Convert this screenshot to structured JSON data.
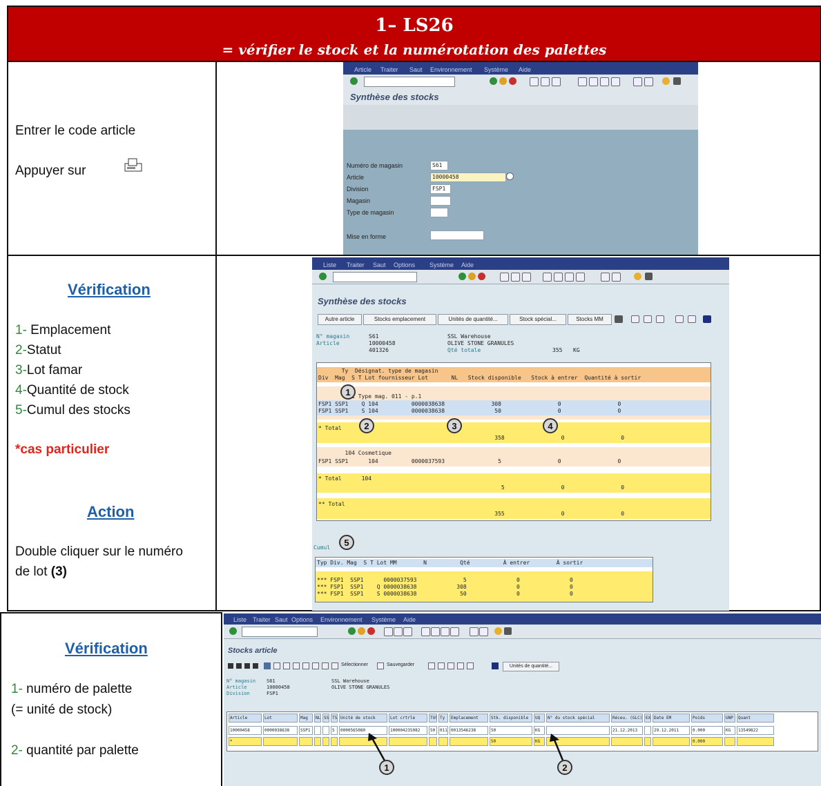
{
  "header": {
    "title": "1– LS26",
    "subtitle": "= vérifier le stock et la numérotation des palettes"
  },
  "row1": {
    "instruction_1": "Entrer le code article",
    "instruction_2": "Appuyer sur",
    "sap": {
      "menu": [
        "Article",
        "Traiter",
        "Saut",
        "Environnement",
        "Système",
        "Aide"
      ],
      "screen_title": "Synthèse des stocks",
      "fields": [
        {
          "label": "Numéro de magasin",
          "value": "S61"
        },
        {
          "label": "Article",
          "value": "10000458"
        },
        {
          "label": "Division",
          "value": "FSP1"
        },
        {
          "label": "Magasin",
          "value": ""
        },
        {
          "label": "Type de magasin",
          "value": ""
        },
        {
          "label": "Mise en forme",
          "value": ""
        }
      ]
    }
  },
  "row2": {
    "heading_1": "Vérification",
    "list": [
      {
        "num": "1-",
        "text": " Emplacement"
      },
      {
        "num": "2-",
        "text": "Statut"
      },
      {
        "num": "3-",
        "text": "Lot famar"
      },
      {
        "num": "4-",
        "text": "Quantité de stock"
      },
      {
        "num": "5-",
        "text": "Cumul des stocks"
      }
    ],
    "special_case": "*cas particulier",
    "heading_2": "Action",
    "action_1": "Double cliquer sur le numéro",
    "action_2_prefix": "de lot ",
    "action_2_bold": "(3)",
    "sap": {
      "menu": [
        "Liste",
        "Traiter",
        "Saut",
        "Options",
        "Système",
        "Aide"
      ],
      "screen_title": "Synthèse des stocks",
      "buttons": [
        "Autre article",
        "Stocks emplacement",
        "Unités de quantité...",
        "Stock spécial...",
        "Stocks MM"
      ],
      "info_left": [
        "N° magasin",
        "Article",
        ""
      ],
      "info_mid": [
        "S61",
        "10000458",
        "401326"
      ],
      "info_right": [
        "SSL Warehouse",
        "OLIVE STONE GRANULES",
        "Qté totale"
      ],
      "total_qty": "355",
      "unit": "KG",
      "col_row1": "       Ty  Désignat. type de magasin",
      "col_row2": "Div  Mag  S T Lot fournisseur Lot       NL   Stock disponible   Stock à entrer  Quantité à sortir",
      "group1_title": "        011 Type mag. 011 - p.1",
      "group1_rows": [
        "FSP1 SSP1    Q 104          0000038638              308                 0                 0",
        "FSP1 SSP1    S 104          0000038638               50                 0                 0"
      ],
      "total1_label": "* Total",
      "total1_vals": "                                                     358                 0                 0",
      "group2_title": "        104 Cosmetique",
      "group2_rows": [
        "FSP1 SSP1      104          0000037593                5                 0                 0"
      ],
      "total2_label": "* Total      104",
      "total2_vals": "                                                       5                 0                 0",
      "total3_label": "** Total",
      "total3_vals": "                                                     355                 0                 0",
      "cumul_label": "Cumul",
      "cumul_header": "Typ Div. Mag  S T Lot MM        N          Qté          À entrer        À sortir",
      "cumul_rows": [
        "*** FSP1  SSP1      0000037593              5               0               0",
        "*** FSP1  SSP1    Q 0000038638            308               0               0",
        "*** FSP1  SSP1    S 0000038638             50               0               0"
      ]
    }
  },
  "row3": {
    "heading": "Vérification",
    "item1_num": "1-",
    "item1_text": " numéro de palette",
    "item1_text2": "(= unité de stock)",
    "item2_num": "2-",
    "item2_text": " quantité par palette",
    "sap": {
      "menu": [
        "Liste",
        "Traiter",
        "Saut",
        "Options",
        "Environnement",
        "Système",
        "Aide"
      ],
      "screen_title": "Stocks article",
      "toolbar_labels": [
        "Sélectionner",
        "Sauvegarder",
        "Unités de quantité..."
      ],
      "info_left": [
        "N° magasin",
        "Article",
        "Division"
      ],
      "info_mid": [
        "S61",
        "10000458",
        "FSP1"
      ],
      "info_right": [
        "SSL Warehouse",
        "OLIVE STONE GRANULES",
        ""
      ],
      "columns": [
        "Article",
        "Lot",
        "Mag",
        "NL",
        "SS",
        "TS",
        "Unité de stock",
        "Lot crtrle",
        "TUS",
        "Ty",
        "Emplacement",
        "Stk. disponible",
        "UQ",
        "N° du stock spécial",
        "Réceu. (GLC)",
        "EX",
        "Date EM",
        "Poids",
        "UNP",
        "Quant"
      ],
      "row": [
        "10000458",
        "0000038638",
        "SSP1",
        "",
        "",
        "S",
        "0000565080",
        "100004235082",
        "50",
        "011",
        "0013546238",
        "50",
        "KG",
        "",
        "21.12.2013",
        "",
        "29.12.2011",
        "0.000",
        "KG",
        "13549822"
      ],
      "total_row": [
        "*",
        "",
        "",
        "",
        "",
        "",
        "",
        "",
        "",
        "",
        "",
        "50",
        "KG",
        "",
        "",
        "",
        "",
        "0.000",
        "",
        ""
      ]
    }
  },
  "markers": [
    "1",
    "2",
    "3",
    "4",
    "5"
  ]
}
